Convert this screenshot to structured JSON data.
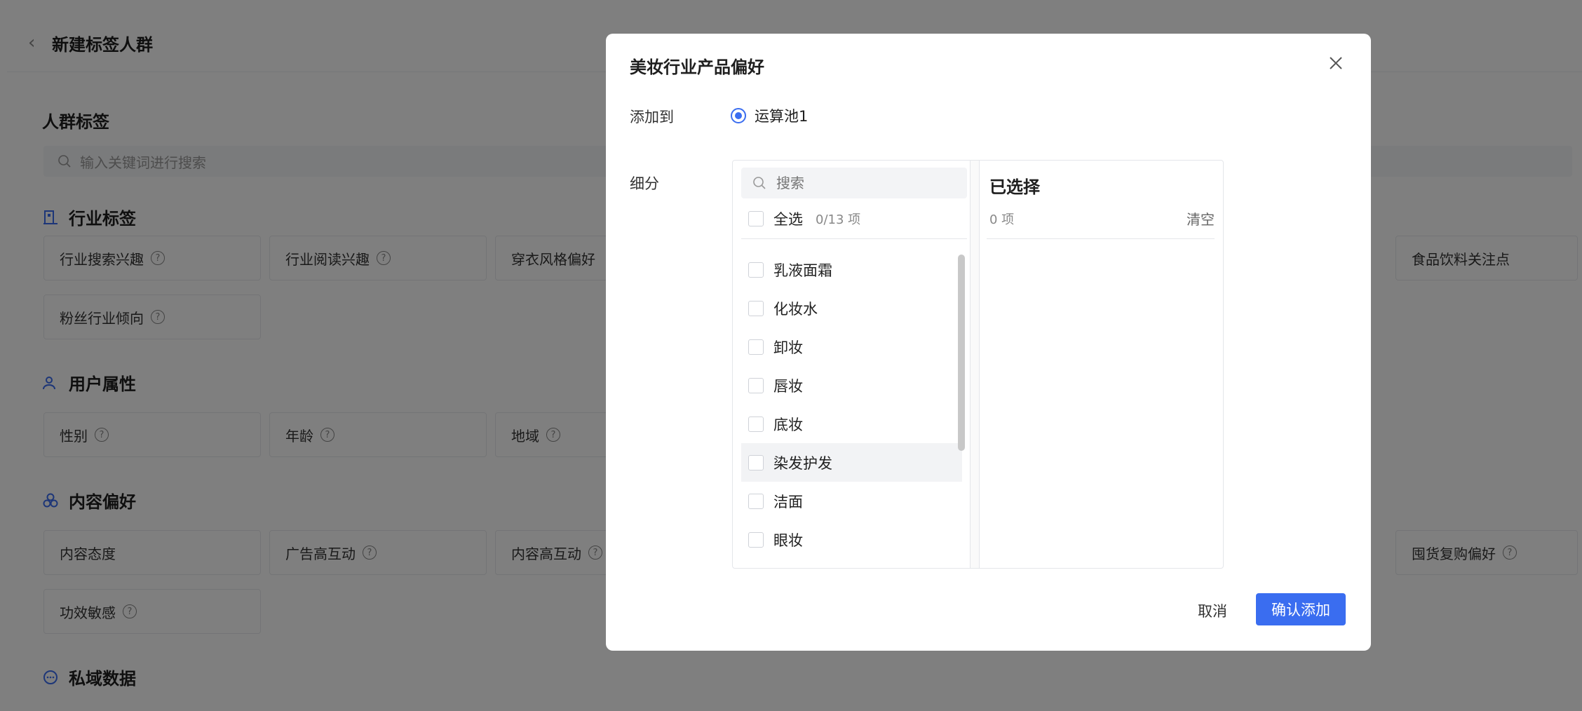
{
  "page": {
    "title": "新建标签人群",
    "crowd_tags_title": "人群标签",
    "search_placeholder": "输入关键词进行搜索"
  },
  "sections": {
    "industry": {
      "title": "行业标签",
      "cards": [
        "行业搜索兴趣",
        "行业阅读兴趣",
        "穿衣风格偏好",
        "食品饮料关注点",
        "粉丝行业倾向"
      ]
    },
    "user": {
      "title": "用户属性",
      "cards": [
        "性别",
        "年龄",
        "地域"
      ]
    },
    "content": {
      "title": "内容偏好",
      "cards": [
        "内容态度",
        "广告高互动",
        "内容高互动",
        "囤货复购偏好",
        "功效敏感"
      ]
    },
    "private": {
      "title": "私域数据"
    }
  },
  "modal": {
    "title": "美妆行业产品偏好",
    "add_to_label": "添加到",
    "pool_option": "运算池1",
    "segment_label": "细分",
    "search_placeholder": "搜索",
    "select_all": "全选",
    "select_count": "0/13 项",
    "items": [
      "乳液面霜",
      "化妆水",
      "卸妆",
      "唇妆",
      "底妆",
      "染发护发",
      "洁面",
      "眼妆"
    ],
    "selected_title": "已选择",
    "selected_count": "0 项",
    "clear": "清空",
    "cancel": "取消",
    "confirm": "确认添加"
  },
  "colors": {
    "accent": "#3a6df0",
    "overlay": "rgba(0,0,0,0.5)"
  }
}
